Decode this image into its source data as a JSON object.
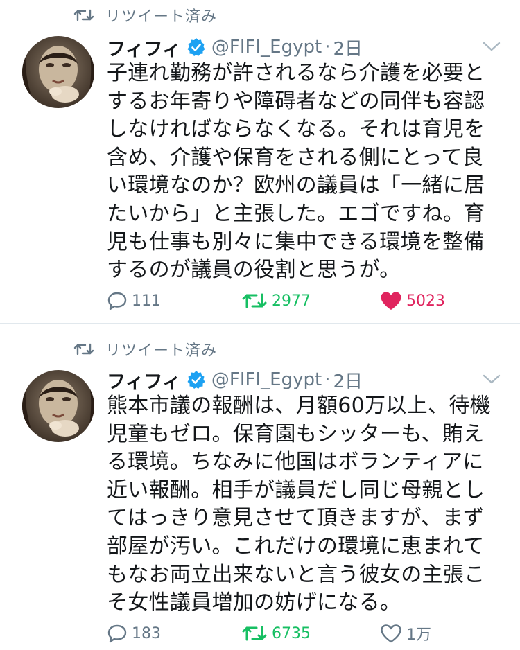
{
  "colors": {
    "text": "#14171a",
    "muted": "#657786",
    "verified": "#1da1f2",
    "retweet_green": "#17bf63",
    "like_red": "#e0245e",
    "divider": "#e1e8ed"
  },
  "tweets": [
    {
      "retweet_label": "リツイート済み",
      "name": "フィフィ",
      "verified": true,
      "handle": "@FIFI_Egypt",
      "separator": "·",
      "time": "2日",
      "text": "子連れ勤務が許されるなら介護を必要と\nするお年寄りや障碍者などの同伴も容認\nしなければならなくなる。それは育児を\n含め、介護や保育をされる側にとって良\nい環境なのか？欧州の議員は「一緒に居\nたいから」と主張した。エゴですね。育\n児も仕事も別々に集中できる環境を整備\nするのが議員の役割と思うが。",
      "replies": "111",
      "retweets": "2977",
      "likes": "5023",
      "liked": true,
      "icons": {
        "reply": "reply-icon",
        "retweet": "retweet-icon",
        "like": "heart-filled-icon",
        "menu": "chevron-down-icon"
      }
    },
    {
      "retweet_label": "リツイート済み",
      "name": "フィフィ",
      "verified": true,
      "handle": "@FIFI_Egypt",
      "separator": "·",
      "time": "2日",
      "text": "熊本市議の報酬は、月額60万以上、待機\n児童もゼロ。保育園もシッターも、賄え\nる環境。ちなみに他国はボランティアに\n近い報酬。相手が議員だし同じ母親とし\nてはっきり意見させて頂きますが、まず\n部屋が汚い。これだけの環境に恵まれて\nもなお両立出来ないと言う彼女の主張こ\nそ女性議員増加の妨げになる。",
      "replies": "183",
      "retweets": "6735",
      "likes": "1万",
      "liked": false,
      "icons": {
        "reply": "reply-icon",
        "retweet": "retweet-icon",
        "like": "heart-outline-icon",
        "menu": "chevron-down-icon"
      }
    }
  ]
}
